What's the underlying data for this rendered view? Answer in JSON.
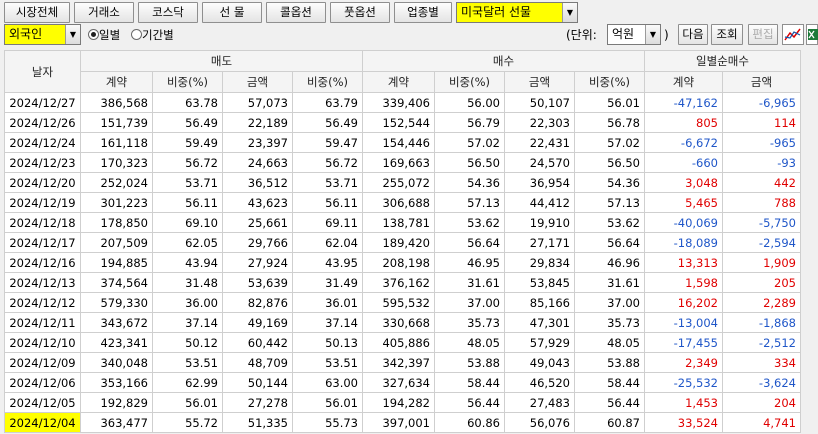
{
  "toolbar": {
    "buttons": [
      "시장전체",
      "거래소",
      "코스닥",
      "선 물",
      "콜옵션",
      "풋옵션",
      "업종별"
    ],
    "product_select": "미국달러 선물"
  },
  "filter": {
    "investor_select": "외국인",
    "period_options": [
      {
        "label": "일별",
        "selected": true
      },
      {
        "label": "기간별",
        "selected": false
      }
    ],
    "unit_label": "(단위:",
    "unit_select": "억원",
    "unit_close": ")",
    "next_label": "다음",
    "query_label": "조회",
    "edit_label": "편집"
  },
  "table": {
    "date_header": "날자",
    "groups": [
      "매도",
      "매수",
      "일별순매수"
    ],
    "subheaders": [
      "계약",
      "비중(%)",
      "금액",
      "비중(%)",
      "계약",
      "비중(%)",
      "금액",
      "비중(%)",
      "계약",
      "금액"
    ],
    "rows": [
      [
        "2024/12/27",
        "386,568",
        "63.78",
        "57,073",
        "63.79",
        "339,406",
        "56.00",
        "50,107",
        "56.01",
        "-47,162",
        "-6,965"
      ],
      [
        "2024/12/26",
        "151,739",
        "56.49",
        "22,189",
        "56.49",
        "152,544",
        "56.79",
        "22,303",
        "56.78",
        "805",
        "114"
      ],
      [
        "2024/12/24",
        "161,118",
        "59.49",
        "23,397",
        "59.47",
        "154,446",
        "57.02",
        "22,431",
        "57.02",
        "-6,672",
        "-965"
      ],
      [
        "2024/12/23",
        "170,323",
        "56.72",
        "24,663",
        "56.72",
        "169,663",
        "56.50",
        "24,570",
        "56.50",
        "-660",
        "-93"
      ],
      [
        "2024/12/20",
        "252,024",
        "53.71",
        "36,512",
        "53.71",
        "255,072",
        "54.36",
        "36,954",
        "54.36",
        "3,048",
        "442"
      ],
      [
        "2024/12/19",
        "301,223",
        "56.11",
        "43,623",
        "56.11",
        "306,688",
        "57.13",
        "44,412",
        "57.13",
        "5,465",
        "788"
      ],
      [
        "2024/12/18",
        "178,850",
        "69.10",
        "25,661",
        "69.11",
        "138,781",
        "53.62",
        "19,910",
        "53.62",
        "-40,069",
        "-5,750"
      ],
      [
        "2024/12/17",
        "207,509",
        "62.05",
        "29,766",
        "62.04",
        "189,420",
        "56.64",
        "27,171",
        "56.64",
        "-18,089",
        "-2,594"
      ],
      [
        "2024/12/16",
        "194,885",
        "43.94",
        "27,924",
        "43.95",
        "208,198",
        "46.95",
        "29,834",
        "46.96",
        "13,313",
        "1,909"
      ],
      [
        "2024/12/13",
        "374,564",
        "31.48",
        "53,639",
        "31.49",
        "376,162",
        "31.61",
        "53,845",
        "31.61",
        "1,598",
        "205"
      ],
      [
        "2024/12/12",
        "579,330",
        "36.00",
        "82,876",
        "36.01",
        "595,532",
        "37.00",
        "85,166",
        "37.00",
        "16,202",
        "2,289"
      ],
      [
        "2024/12/11",
        "343,672",
        "37.14",
        "49,169",
        "37.14",
        "330,668",
        "35.73",
        "47,301",
        "35.73",
        "-13,004",
        "-1,868"
      ],
      [
        "2024/12/10",
        "423,341",
        "50.12",
        "60,442",
        "50.13",
        "405,886",
        "48.05",
        "57,929",
        "48.05",
        "-17,455",
        "-2,512"
      ],
      [
        "2024/12/09",
        "340,048",
        "53.51",
        "48,709",
        "53.51",
        "342,397",
        "53.88",
        "49,043",
        "53.88",
        "2,349",
        "334"
      ],
      [
        "2024/12/06",
        "353,166",
        "62.99",
        "50,144",
        "63.00",
        "327,634",
        "58.44",
        "46,520",
        "58.44",
        "-25,532",
        "-3,624"
      ],
      [
        "2024/12/05",
        "192,829",
        "56.01",
        "27,278",
        "56.01",
        "194,282",
        "56.44",
        "27,483",
        "56.44",
        "1,453",
        "204"
      ],
      [
        "2024/12/04",
        "363,477",
        "55.72",
        "51,335",
        "55.73",
        "397,001",
        "60.86",
        "56,076",
        "60.87",
        "33,524",
        "4,741"
      ]
    ]
  },
  "colors": {
    "highlight": "#ffff00",
    "positive": "#e00000",
    "negative": "#1f56c8"
  }
}
